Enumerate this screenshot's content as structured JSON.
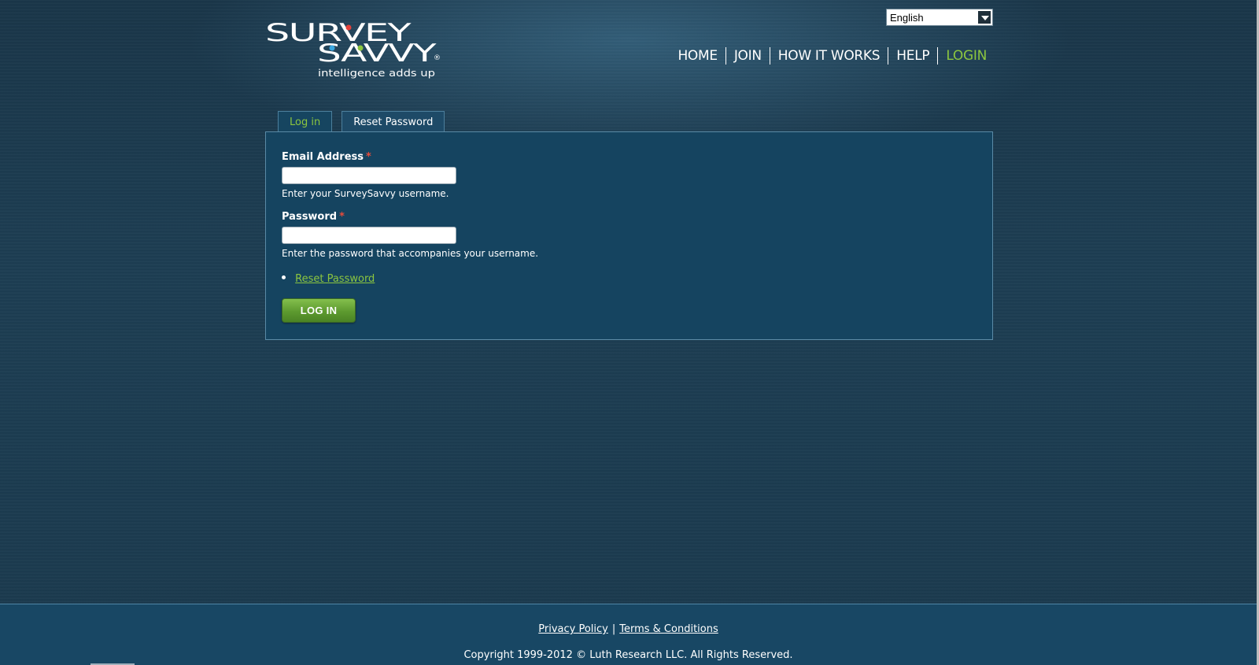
{
  "logo": {
    "line1": "SURVEY",
    "line2": "SAVVY",
    "tagline": "intelligence adds up",
    "registered": "®"
  },
  "language": {
    "selected": "English"
  },
  "nav": {
    "items": [
      {
        "label": "HOME"
      },
      {
        "label": "JOIN"
      },
      {
        "label": "HOW IT WORKS"
      },
      {
        "label": "HELP"
      },
      {
        "label": "LOGIN"
      }
    ]
  },
  "tabs": [
    {
      "label": "Log in"
    },
    {
      "label": "Reset Password"
    }
  ],
  "form": {
    "email_label": "Email Address",
    "email_value": "",
    "email_help": "Enter your SurveySavvy username.",
    "password_label": "Password",
    "password_value": "",
    "password_help": "Enter the password that accompanies your username.",
    "required_mark": "*",
    "reset_link": "Reset Password",
    "submit_label": "LOG IN"
  },
  "footer": {
    "privacy": "Privacy Policy",
    "separator": "|",
    "terms": "Terms & Conditions",
    "copyright": "Copyright 1999-2012 © Luth Research LLC. All Rights Reserved."
  },
  "colors": {
    "accent_green": "#8cc63f",
    "required_red": "#e64b3b",
    "panel_bg": "#154460",
    "page_bg": "#1b3a4e"
  }
}
